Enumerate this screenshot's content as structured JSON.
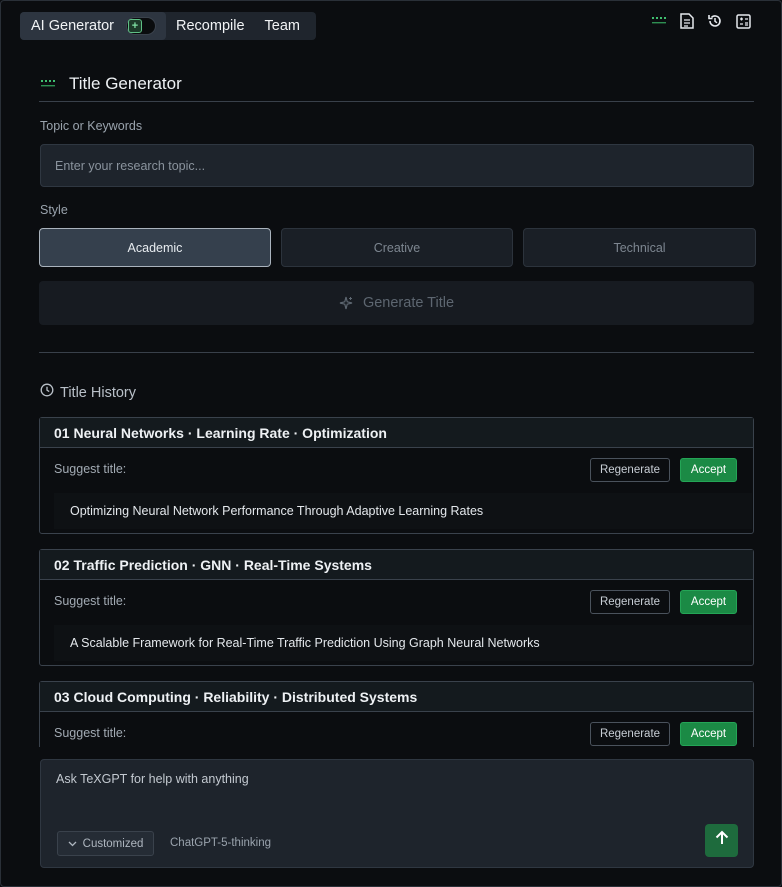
{
  "top_tabs": [
    {
      "label": "AI Generator"
    },
    {
      "label": "Recompile"
    },
    {
      "label": "Team"
    }
  ],
  "top_icons": [
    "dots-icon",
    "document-icon",
    "history-icon",
    "calculator-icon"
  ],
  "panel": {
    "title": "Title Generator",
    "topic_label": "Topic or Keywords",
    "topic_placeholder": "Enter your research topic...",
    "topic_value": "",
    "style_label": "Style",
    "styles": [
      "Academic",
      "Creative",
      "Technical"
    ],
    "selected_style": "Academic",
    "generate_label": "Generate Title"
  },
  "history": {
    "label": "Title History",
    "suggest_label": "Suggest title:",
    "regenerate_label": "Regenerate",
    "accept_label": "Accept",
    "items": [
      {
        "heading": "01 Neural Networks · Learning Rate · Optimization",
        "title": "Optimizing Neural Network Performance Through Adaptive Learning Rates"
      },
      {
        "heading": "02 Traffic Prediction · GNN · Real-Time Systems",
        "title": "A Scalable Framework for Real-Time Traffic Prediction Using Graph Neural Networks"
      },
      {
        "heading": "03 Cloud Computing · Reliability · Distributed Systems",
        "title": ""
      }
    ]
  },
  "chat": {
    "placeholder": "Ask TeXGPT for help with anything",
    "mode_label": "Customized",
    "model_label": "ChatGPT-5-thinking"
  },
  "colors": {
    "accent_green": "#1b8a45",
    "background": "#0b0d10",
    "input_bg": "#1e242c"
  }
}
